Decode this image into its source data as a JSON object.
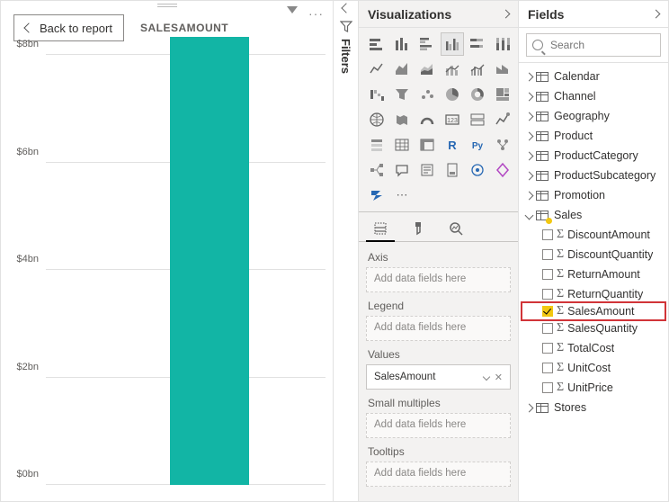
{
  "report": {
    "back_label": "Back to report",
    "visual_title": "SALESAMOUNT"
  },
  "filters": {
    "label": "Filters"
  },
  "viz": {
    "panel_title": "Visualizations",
    "wells": {
      "axis": {
        "label": "Axis",
        "placeholder": "Add data fields here"
      },
      "legend": {
        "label": "Legend",
        "placeholder": "Add data fields here"
      },
      "values": {
        "label": "Values",
        "field": "SalesAmount"
      },
      "small_multiples": {
        "label": "Small multiples",
        "placeholder": "Add data fields here"
      },
      "tooltips": {
        "label": "Tooltips",
        "placeholder": "Add data fields here"
      }
    }
  },
  "fields": {
    "panel_title": "Fields",
    "search_placeholder": "Search",
    "tables": [
      {
        "name": "Calendar",
        "expanded": false
      },
      {
        "name": "Channel",
        "expanded": false
      },
      {
        "name": "Geography",
        "expanded": false
      },
      {
        "name": "Product",
        "expanded": false
      },
      {
        "name": "ProductCategory",
        "expanded": false
      },
      {
        "name": "ProductSubcategory",
        "expanded": false
      },
      {
        "name": "Promotion",
        "expanded": false
      },
      {
        "name": "Sales",
        "expanded": true,
        "has_checked": true,
        "fields": [
          {
            "name": "DiscountAmount",
            "checked": false
          },
          {
            "name": "DiscountQuantity",
            "checked": false
          },
          {
            "name": "ReturnAmount",
            "checked": false
          },
          {
            "name": "ReturnQuantity",
            "checked": false
          },
          {
            "name": "SalesAmount",
            "checked": true,
            "highlight": true
          },
          {
            "name": "SalesQuantity",
            "checked": false
          },
          {
            "name": "TotalCost",
            "checked": false
          },
          {
            "name": "UnitCost",
            "checked": false
          },
          {
            "name": "UnitPrice",
            "checked": false
          }
        ]
      },
      {
        "name": "Stores",
        "expanded": false
      }
    ]
  },
  "chart_data": {
    "type": "bar",
    "categories": [
      ""
    ],
    "values": [
      8.34
    ],
    "unit": "bn",
    "title": "SALESAMOUNT",
    "xlabel": "",
    "ylabel": "",
    "ylim": [
      0,
      8
    ],
    "y_ticks": [
      "$0bn",
      "$2bn",
      "$4bn",
      "$6bn",
      "$8bn"
    ]
  }
}
